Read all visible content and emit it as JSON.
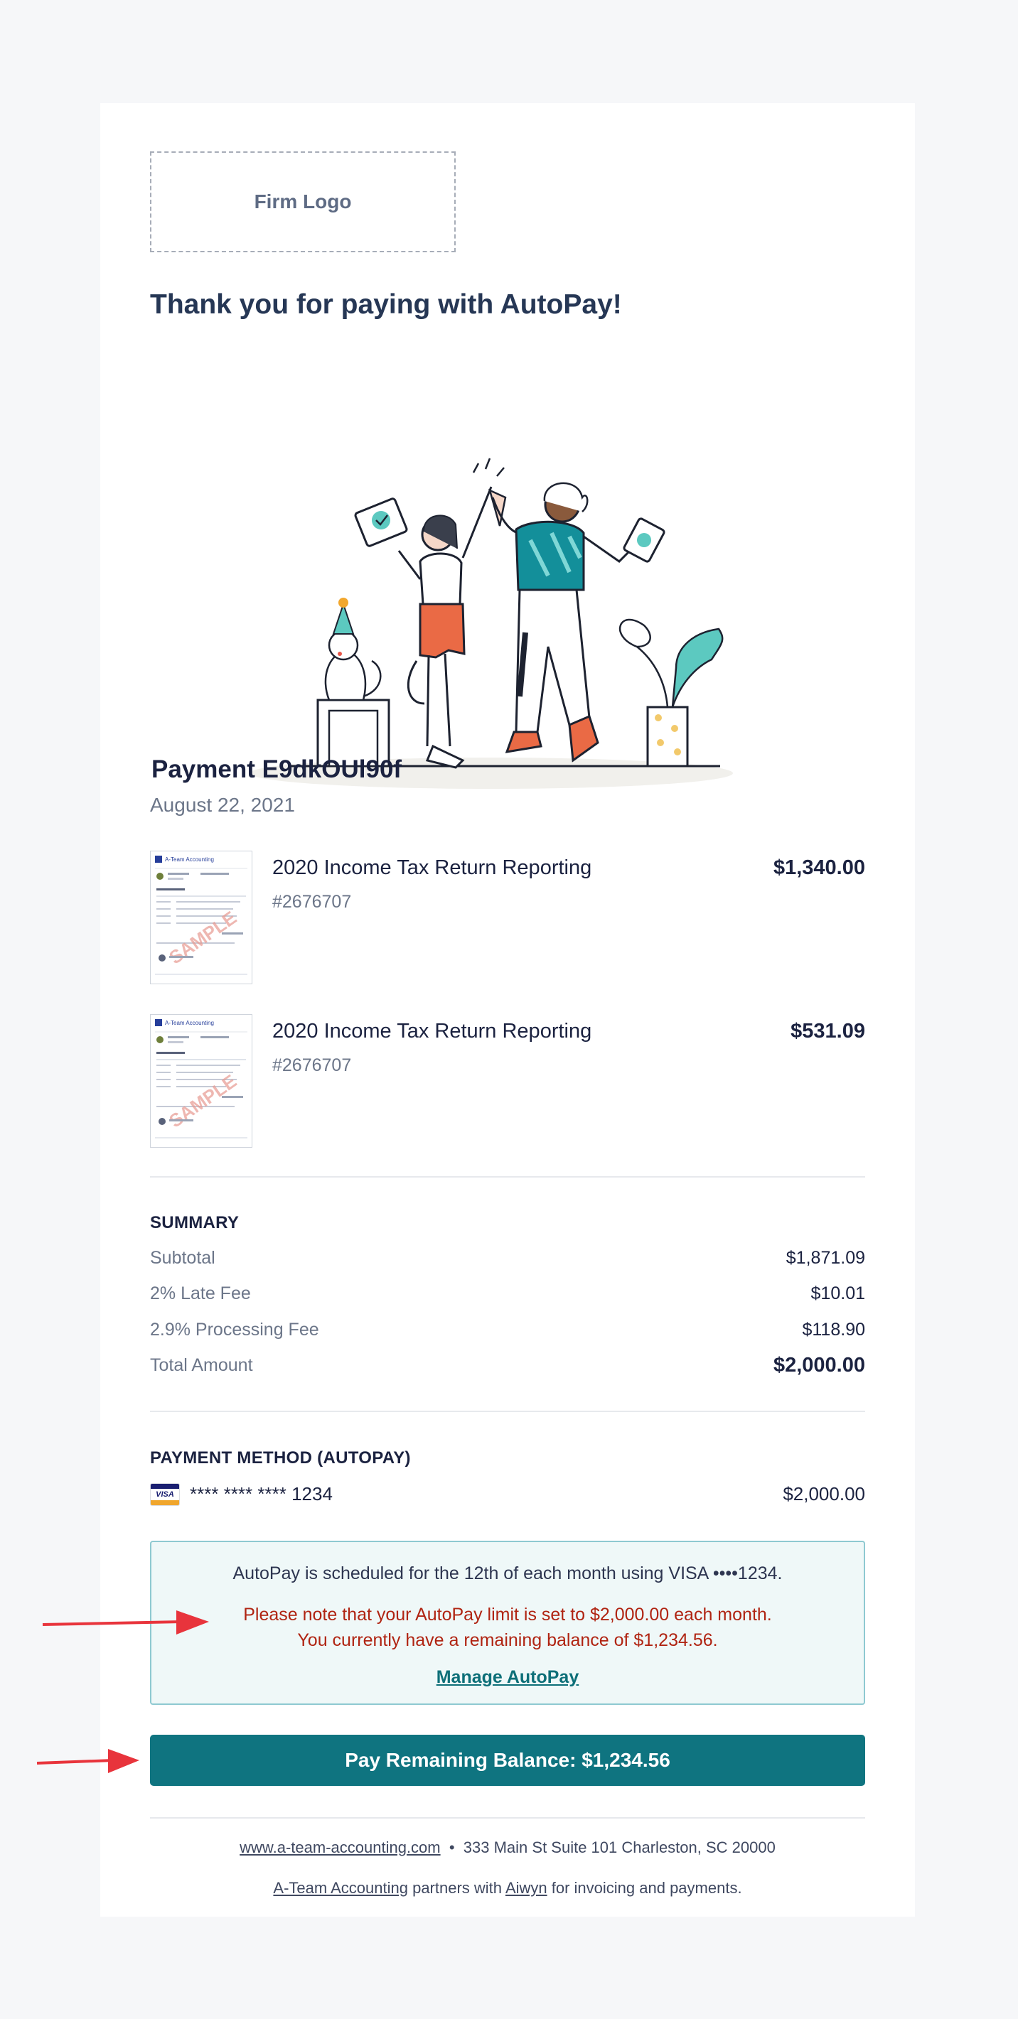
{
  "logo": {
    "label": "Firm Logo"
  },
  "headline": "Thank you for paying with AutoPay!",
  "payment": {
    "title": "Payment E9dkOUl90f",
    "date": "August 22, 2021"
  },
  "items": [
    {
      "title": "2020 Income Tax Return Reporting",
      "number": "#2676707",
      "amount": "$1,340.00",
      "thumb_brand": "A-Team Accounting",
      "thumb_stamp": "SAMPLE"
    },
    {
      "title": "2020 Income Tax Return Reporting",
      "number": "#2676707",
      "amount": "$531.09",
      "thumb_brand": "A-Team Accounting",
      "thumb_stamp": "SAMPLE"
    }
  ],
  "summary": {
    "heading": "SUMMARY",
    "rows": [
      {
        "label": "Subtotal",
        "value": "$1,871.09"
      },
      {
        "label": "2% Late Fee",
        "value": "$10.01"
      },
      {
        "label": "2.9% Processing Fee",
        "value": "$118.90"
      },
      {
        "label": "Total Amount",
        "value": "$2,000.00"
      }
    ]
  },
  "payment_method": {
    "heading": "PAYMENT METHOD (AUTOPAY)",
    "card_brand": "VISA",
    "card_number": "**** **** **** 1234",
    "amount": "$2,000.00"
  },
  "autopay_notice": {
    "schedule": "AutoPay is scheduled for the 12th of each month using VISA ••••1234.",
    "limit": "Please note that your AutoPay limit is set to $2,000.00 each month.",
    "balance": "You currently have a remaining balance of $1,234.56.",
    "manage_link": "Manage AutoPay"
  },
  "pay_button": "Pay Remaining Balance: $1,234.56",
  "footer": {
    "website": "www.a-team-accounting.com",
    "separator": "•",
    "address": "333 Main St Suite 101 Charleston, SC 20000",
    "firm_name": "A-Team Accounting",
    "partners_text": "partners with",
    "partner_name": "Aiwyn",
    "suffix": "for invoicing and payments."
  },
  "colors": {
    "page_bg": "#f6f7f9",
    "accent_teal": "#0f7480",
    "notice_bg": "#eff8f8",
    "notice_border": "#8ec9d1",
    "warning_red": "#b02412",
    "annotation_arrow": "#e8343c"
  }
}
